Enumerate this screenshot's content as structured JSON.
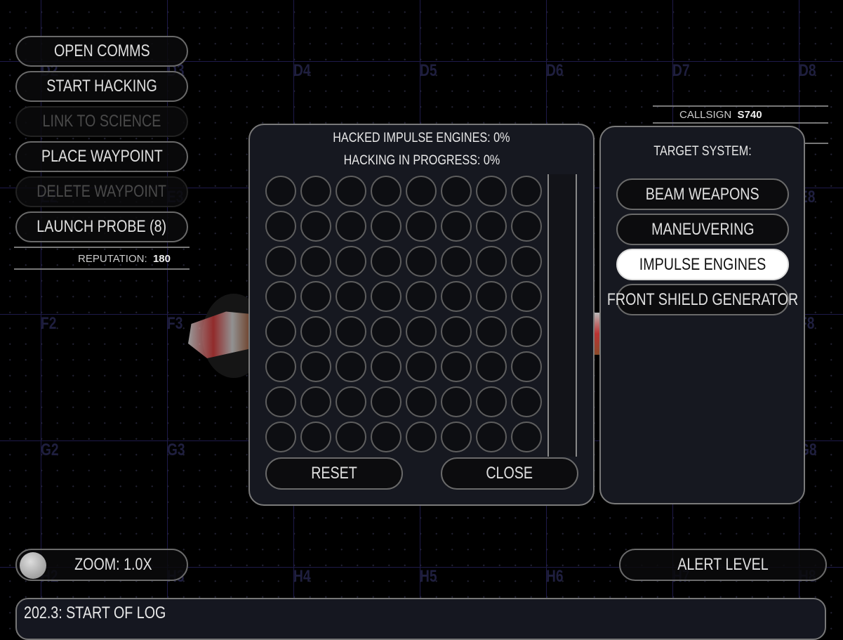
{
  "sectors": {
    "rowD": [
      "D2",
      "D3",
      "D4",
      "D5",
      "D6",
      "D7",
      "D8"
    ],
    "rowE": [
      "E2",
      "E3",
      "E8"
    ],
    "rowF": [
      "F2",
      "F3",
      "F8"
    ],
    "rowG": [
      "G2",
      "G3",
      "G8"
    ],
    "rowH": [
      "H2",
      "H3",
      "H4",
      "H5",
      "H6",
      "H7",
      "H8"
    ]
  },
  "sidebar": {
    "buttons": [
      {
        "label": "OPEN COMMS",
        "enabled": true
      },
      {
        "label": "START HACKING",
        "enabled": true
      },
      {
        "label": "LINK TO SCIENCE",
        "enabled": false
      },
      {
        "label": "PLACE WAYPOINT",
        "enabled": true
      },
      {
        "label": "DELETE WAYPOINT",
        "enabled": false
      },
      {
        "label": "LAUNCH PROBE (8)",
        "enabled": true
      }
    ],
    "reputation_label": "REPUTATION:",
    "reputation_value": "180"
  },
  "info": {
    "callsign_label": "CALLSIGN",
    "callsign_value": "S740"
  },
  "hacking": {
    "status_hacked": "HACKED IMPULSE ENGINES: 0%",
    "status_progress": "HACKING IN PROGRESS: 0%",
    "grid_rows": 8,
    "grid_cols": 8,
    "reset_label": "RESET",
    "close_label": "CLOSE"
  },
  "target": {
    "title": "TARGET SYSTEM:",
    "systems": [
      "BEAM WEAPONS",
      "MANEUVERING",
      "IMPULSE ENGINES",
      "FRONT SHIELD GENERATOR"
    ],
    "selected": "IMPULSE ENGINES"
  },
  "zoom": {
    "label": "ZOOM: 1.0X",
    "slider_value": 0
  },
  "alert": {
    "label": "ALERT LEVEL"
  },
  "log": {
    "text": "202.3: START OF LOG"
  }
}
